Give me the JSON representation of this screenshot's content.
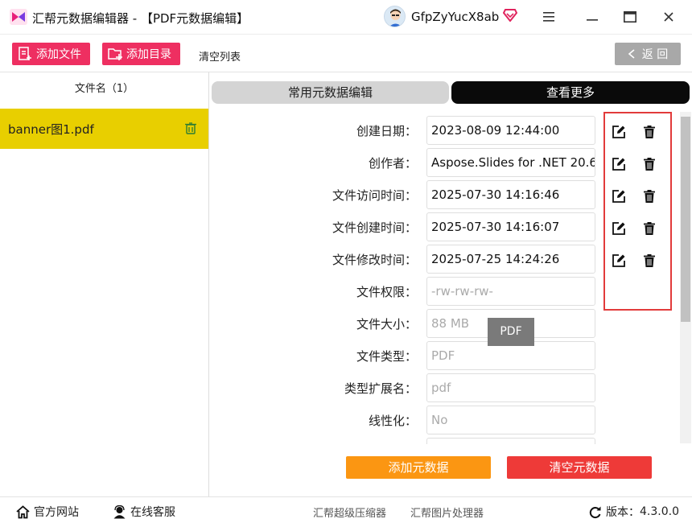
{
  "app": {
    "title": "汇帮元数据编辑器 - 【PDF元数据编辑】",
    "username": "GfpZyYucX8ab",
    "accent_color": "#ee2f61"
  },
  "window_controls": {
    "menu_icon": "hamburger-icon",
    "minimize_icon": "minimize-icon",
    "maximize_icon": "maximize-icon",
    "close_icon": "close-icon"
  },
  "toolbar": {
    "add_file_label": "添加文件",
    "add_dir_label": "添加目录",
    "clear_list_label": "清空列表",
    "back_label": "返 回"
  },
  "file_list": {
    "header": "文件名（1）",
    "files": [
      {
        "name": "banner图1.pdf"
      }
    ]
  },
  "tabs": {
    "common": "常用元数据编辑",
    "more": "查看更多"
  },
  "fields": [
    {
      "label": "创建日期：",
      "value": "2023-08-09 12:44:00"
    },
    {
      "label": "创作者：",
      "value": "Aspose.Slides for .NET 20.6"
    },
    {
      "label": "文件访问时间：",
      "value": "2025-07-30 14:16:46"
    },
    {
      "label": "文件创建时间：",
      "value": "2025-07-30 14:16:07"
    },
    {
      "label": "文件修改时间：",
      "value": "2025-07-25 14:24:26"
    },
    {
      "label": "文件权限：",
      "value": "-rw-rw-rw-"
    },
    {
      "label": "文件大小：",
      "value": "88 MB"
    },
    {
      "label": "文件类型：",
      "value": "PDF"
    },
    {
      "label": "类型扩展名：",
      "value": "pdf"
    },
    {
      "label": "线性化：",
      "value": "No"
    }
  ],
  "tooltip": "PDF",
  "actions": {
    "add_metadata": "添加元数据",
    "clear_metadata": "清空元数据"
  },
  "status": {
    "website": "官方网站",
    "support": "在线客服",
    "compressor": "汇帮超级压缩器",
    "image_tool": "汇帮图片处理器",
    "version_label": "版本：",
    "version": "4.3.0.0"
  }
}
